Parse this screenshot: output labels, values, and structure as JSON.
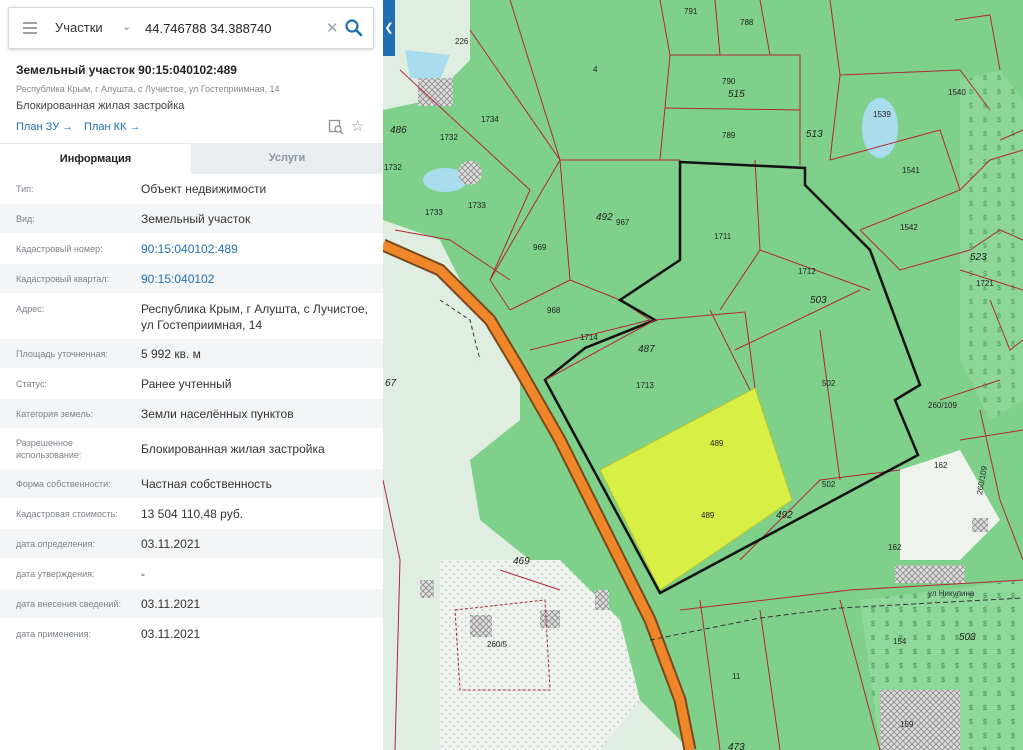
{
  "search": {
    "layer": "Участки",
    "query": "44.746788 34.388740"
  },
  "parcel": {
    "title": "Земельный участок 90:15:040102:489",
    "address": "Республика Крым, г Алушта, с Лучистое, ул Гостеприимная, 14",
    "type": "Блокированная жилая застройка",
    "plan_zu": "План ЗУ →",
    "plan_kk": "План КК →"
  },
  "tabs": {
    "info": "Информация",
    "services": "Услуги"
  },
  "rows": [
    {
      "label": "Тип:",
      "value": "Объект недвижимости"
    },
    {
      "label": "Вид:",
      "value": "Земельный участок"
    },
    {
      "label": "Кадастровый номер:",
      "value": "90:15:040102:489"
    },
    {
      "label": "Кадастровый квартал:",
      "value": "90:15:040102"
    },
    {
      "label": "Адрес:",
      "value": "Республика Крым, г Алушта, с Лучистое, ул Гостеприимная, 14"
    },
    {
      "label": "Площадь уточненная:",
      "value": "5 992 кв. м"
    },
    {
      "label": "Статус:",
      "value": "Ранее учтенный"
    },
    {
      "label": "Категория земель:",
      "value": "Земли населённых пунктов"
    },
    {
      "label": "Разрешенное использование:",
      "value": "Блокированная жилая застройка"
    },
    {
      "label": "Форма собственности:",
      "value": "Частная собственность"
    },
    {
      "label": "Кадастровая стоимость:",
      "value": "13 504 110,48 руб."
    },
    {
      "label": "дата определения:",
      "value": "03.11.2021"
    },
    {
      "label": "дата утверждения:",
      "value": "-"
    },
    {
      "label": "дата внесения сведений:",
      "value": "03.11.2021"
    },
    {
      "label": "дата применения:",
      "value": "03.11.2021"
    }
  ],
  "map": {
    "plot_labels": [
      "791",
      "788",
      "226",
      "4",
      "790",
      "789",
      "1540",
      "1734",
      "1539",
      "1732",
      "1732",
      "1541",
      "1733",
      "1733",
      "967",
      "969",
      "1711",
      "1542",
      "1712",
      "1721",
      "968",
      "1714",
      "1713",
      "502",
      "260/109",
      "489",
      "489",
      "502",
      "162",
      "162",
      "260/109",
      "260/5",
      "154",
      "11",
      "159"
    ],
    "elevation_labels": [
      "515",
      "486",
      "513",
      "492",
      "523",
      "503",
      "487",
      "67",
      "492",
      "469",
      "503",
      "473"
    ],
    "street": "ул Никулина",
    "colors": {
      "forest": "#7fd08a",
      "selected_parcel": "#d8f046",
      "boundary": "#111111",
      "road": "#f0862a",
      "parcel_line": "#b3263a"
    }
  }
}
